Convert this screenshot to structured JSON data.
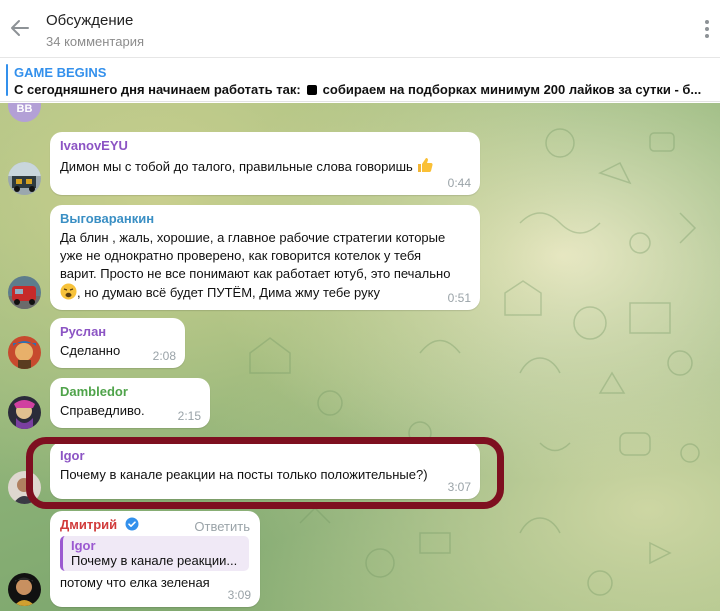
{
  "header": {
    "title": "Обсуждение",
    "subtitle": "34 комментария"
  },
  "pinned": {
    "title": "GAME BEGINS",
    "text_before": "С сегодняшнего дня начинаем работать так:",
    "text_after": "собираем на подборках минимум 200 лайков за сутки - б..."
  },
  "messages": [
    {
      "avatar_initials": "BB"
    },
    {
      "name": "IvanovEYU",
      "name_color": "#8c54c4",
      "text": "Димон мы с тобой до талого, правильные слова говоришь",
      "time": "0:44"
    },
    {
      "name": "Выговаранкин",
      "name_color": "#3a8fc4",
      "lines": [
        "Да блин , жаль, хорошие, а главное рабочие стратегии которые",
        "уже не однократно проверено, как говорится котелок у тебя",
        "варит. Просто не все понимают как работает ютуб, это печально"
      ],
      "last_line": ", но думаю всё будет ПУТЁМ, Дима жму тебе руку",
      "time": "0:51"
    },
    {
      "name": "Руслан",
      "name_color": "#8c54c4",
      "text": "Сделанно",
      "time": "2:08"
    },
    {
      "name": "Dambledor",
      "name_color": "#4fa34a",
      "text": "Справедливо.",
      "time": "2:15"
    },
    {
      "name": "Igor",
      "name_color": "#8c54c4",
      "text": "Почему в канале реакции на посты только положительные?)",
      "time": "3:07"
    },
    {
      "name": "Дмитрий",
      "name_color": "#d13b3b",
      "reply_label": "Ответить",
      "quote_name": "Igor",
      "quote_text": "Почему в канале реакции...",
      "text": "потому что елка зеленая",
      "time": "3:09"
    }
  ],
  "colors": {
    "accent": "#3390ec",
    "highlight_ring": "#7e0f20"
  }
}
